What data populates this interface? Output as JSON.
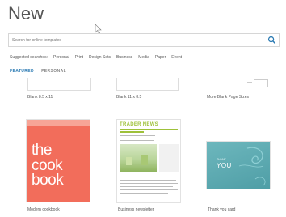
{
  "page": {
    "title": "New"
  },
  "search": {
    "placeholder": "Search for online templates"
  },
  "suggested": {
    "label": "Suggested searches:",
    "items": [
      "Personal",
      "Print",
      "Design Sets",
      "Business",
      "Media",
      "Paper",
      "Event"
    ]
  },
  "tabs": {
    "featured": "FEATURED",
    "personal": "PERSONAL"
  },
  "templates_top": [
    "Blank 8.5 x 11",
    "Blank 11 x 8.5",
    "More Blank Page Sizes"
  ],
  "templates": [
    {
      "name": "Modern cookbook",
      "words": [
        "the",
        "cook",
        "book"
      ]
    },
    {
      "name": "Business newsletter",
      "masthead": "TRADER NEWS"
    },
    {
      "name": "Thank you card",
      "small": "THANK",
      "big": "YOU"
    }
  ],
  "colors": {
    "accent": "#2a7ab3",
    "cookbook": "#f26d5b",
    "newsletter": "#9ec13a",
    "card": "#5aa9b0"
  }
}
